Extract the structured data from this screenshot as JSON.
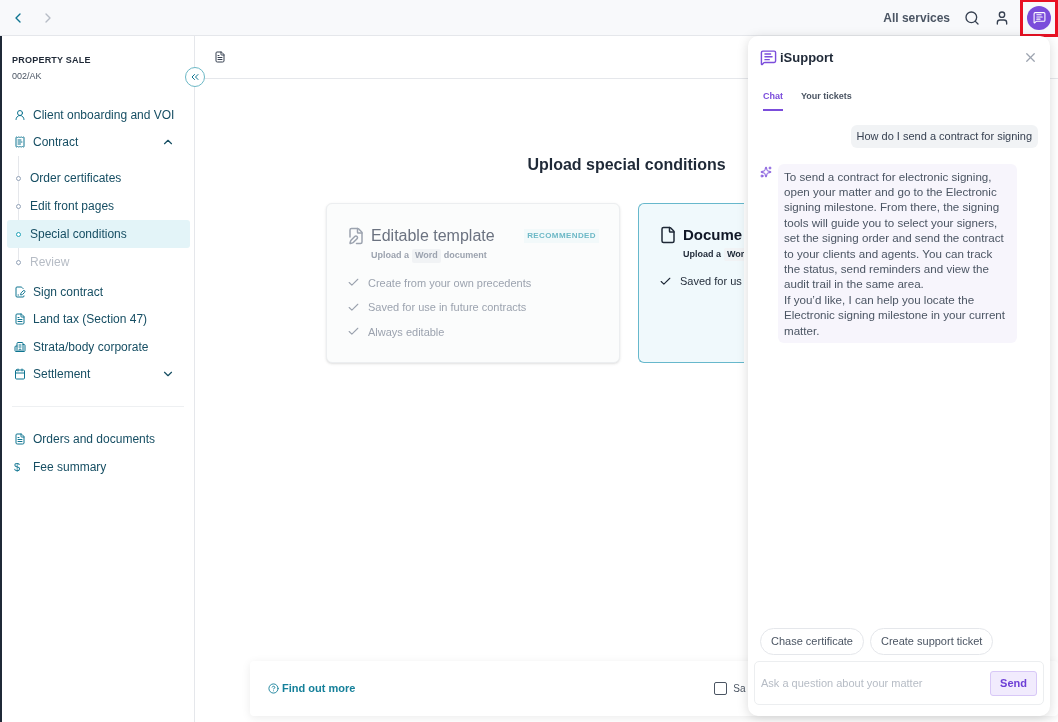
{
  "top_bar": {
    "back_enabled": true,
    "forward_enabled": false,
    "all_services": "All services",
    "chat_button_highlighted": true
  },
  "sidebar": {
    "title": "PROPERTY SALE",
    "reference": "002/AK",
    "items": [
      {
        "kind": "item",
        "label": "Client onboarding and VOI"
      },
      {
        "kind": "group",
        "label": "Contract",
        "expanded": true,
        "children": [
          {
            "label": "Order certificates",
            "selected": false,
            "disabled": false
          },
          {
            "label": "Edit front pages",
            "selected": false,
            "disabled": false
          },
          {
            "label": "Special conditions",
            "selected": true,
            "disabled": false
          },
          {
            "label": "Review",
            "selected": false,
            "disabled": true
          }
        ]
      },
      {
        "kind": "item",
        "label": "Sign contract"
      },
      {
        "kind": "item",
        "label": "Land tax (Section 47)"
      },
      {
        "kind": "item",
        "label": "Strata/body corporate"
      },
      {
        "kind": "group",
        "label": "Settlement",
        "expanded": false
      }
    ],
    "footer_items": [
      {
        "label": "Orders and documents"
      },
      {
        "label": "Fee summary",
        "icon_text": "$"
      }
    ]
  },
  "main": {
    "heading": "Upload special conditions",
    "cards": [
      {
        "title": "Editable template",
        "badge": "RECOMMENDED",
        "subtitle": [
          "Upload a",
          "Word",
          "document"
        ],
        "selected": false,
        "features": [
          "Create from your own precedents",
          "Saved for use in future contracts",
          "Always editable"
        ]
      },
      {
        "title": "Docume",
        "subtitle": [
          "Upload a",
          "Wor"
        ],
        "selected": true,
        "features": [
          "Saved for us"
        ]
      }
    ],
    "footer": {
      "link": "Find out more",
      "checkbox_label": "Sa",
      "checked": false
    }
  },
  "chat": {
    "title": "iSupport",
    "tabs": [
      {
        "label": "Chat",
        "selected": true
      },
      {
        "label": "Your tickets",
        "selected": false
      }
    ],
    "messages": [
      {
        "kind": "user",
        "text": "How do I send a contract for signing"
      },
      {
        "kind": "bot",
        "paragraphs": [
          "To send a contract for electronic signing, open your matter and go to the Electronic signing milestone. From there, the signing tools will guide you to select your signers, set the signing order and send the contract to your clients and agents. You can track the status, send reminders and view the audit trail in the same area.",
          "If you’d like, I can help you locate the Electronic signing milestone in your current matter."
        ]
      }
    ],
    "suggestions": [
      "Chase certificate",
      "Create support ticket"
    ],
    "input": {
      "placeholder": "Ask a question about your matter"
    },
    "send": "Send"
  }
}
